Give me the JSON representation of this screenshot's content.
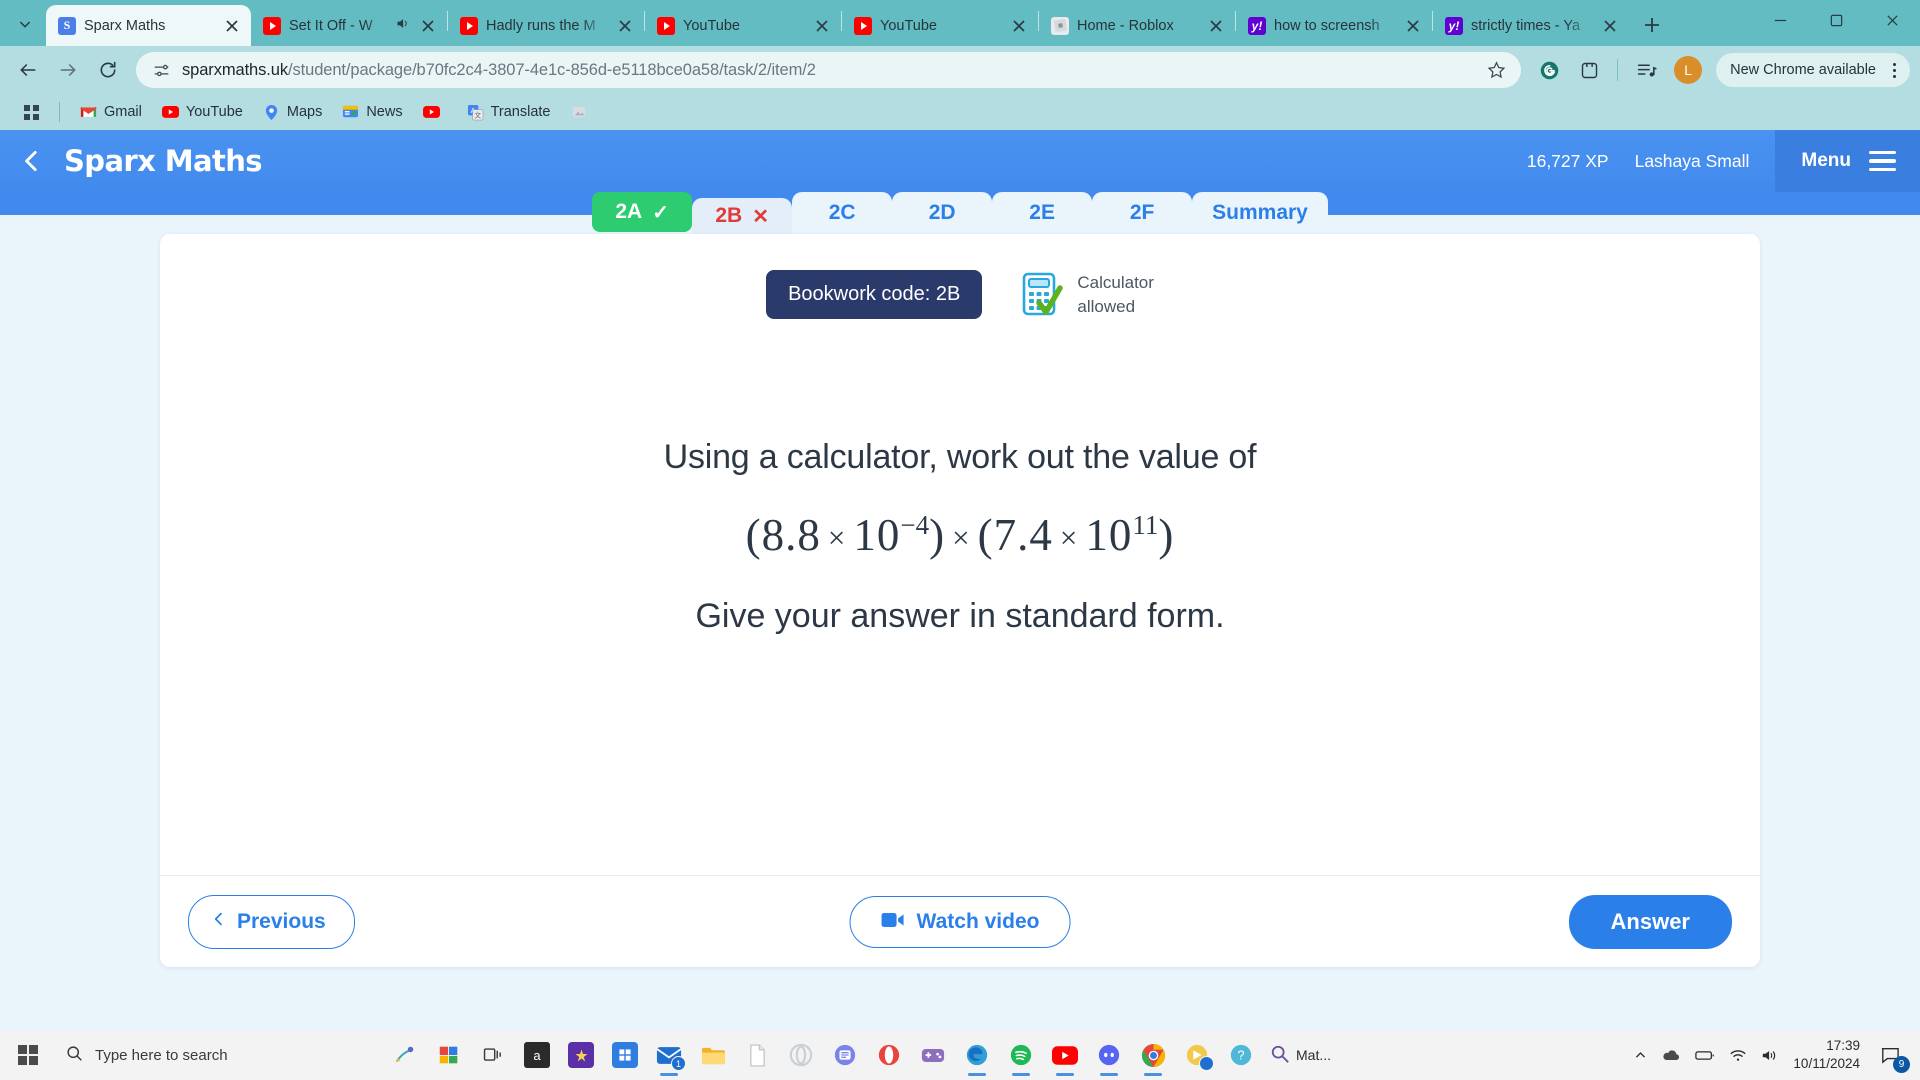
{
  "browser": {
    "tabs": [
      {
        "title": "Sparx Maths",
        "favicon": "sparx-icon",
        "active": true,
        "audio": false
      },
      {
        "title": "Set It Off - W",
        "favicon": "youtube-icon",
        "active": false,
        "audio": true
      },
      {
        "title": "Hadly runs the M",
        "favicon": "youtube-icon",
        "active": false,
        "audio": false
      },
      {
        "title": "YouTube",
        "favicon": "youtube-icon",
        "active": false,
        "audio": false
      },
      {
        "title": "YouTube",
        "favicon": "youtube-icon",
        "active": false,
        "audio": false
      },
      {
        "title": "Home - Roblox",
        "favicon": "roblox-icon",
        "active": false,
        "audio": false
      },
      {
        "title": "how to screensh",
        "favicon": "yahoo-icon",
        "active": false,
        "audio": false
      },
      {
        "title": "strictly times - Ya",
        "favicon": "yahoo-icon",
        "active": false,
        "audio": false
      }
    ],
    "newtab_label": "+",
    "toolbar": {
      "back_icon": "back-arrow-icon",
      "forward_icon": "forward-arrow-icon",
      "reload_icon": "reload-icon",
      "site_settings_icon": "tune-icon",
      "url_domain": "sparxmaths.uk",
      "url_path": "/student/package/b70fc2c4-3807-4e1c-856d-e5118bce0a58/task/2/item/2",
      "bookmark_icon": "star-icon",
      "grammarly_icon": "grammarly-icon",
      "extensions_icon": "extensions-icon",
      "readinglist_icon": "reading-list-icon",
      "profile_initial": "L",
      "update_label": "New Chrome available"
    },
    "bookmarks": [
      {
        "label": "Gmail",
        "icon": "gmail-icon"
      },
      {
        "label": "YouTube",
        "icon": "youtube-icon"
      },
      {
        "label": "Maps",
        "icon": "maps-icon"
      },
      {
        "label": "News",
        "icon": "news-icon"
      },
      {
        "label": "",
        "icon": "youtube-icon"
      },
      {
        "label": "Translate",
        "icon": "translate-icon"
      },
      {
        "label": "",
        "icon": "unknown-icon"
      }
    ],
    "apps_icon": "apps-grid-icon"
  },
  "sparx": {
    "back_icon": "chevron-left-icon",
    "brand": "Sparx Maths",
    "xp": "16,727 XP",
    "user": "Lashaya Small",
    "menu_label": "Menu",
    "menu_icon": "hamburger-icon",
    "task_tabs": [
      {
        "label": "2A",
        "state": "done",
        "mark": "✓"
      },
      {
        "label": "2B",
        "state": "wrong",
        "mark": "✕"
      },
      {
        "label": "2C",
        "state": "normal",
        "mark": ""
      },
      {
        "label": "2D",
        "state": "normal",
        "mark": ""
      },
      {
        "label": "2E",
        "state": "normal",
        "mark": ""
      },
      {
        "label": "2F",
        "state": "normal",
        "mark": ""
      },
      {
        "label": "Summary",
        "state": "normal",
        "mark": ""
      }
    ],
    "bookwork_code": "Bookwork code: 2B",
    "calculator_icon": "calculator-allowed-icon",
    "calculator_line1": "Calculator",
    "calculator_line2": "allowed",
    "question": {
      "line1": "Using a calculator, work out the value of",
      "expr": {
        "open1": "(",
        "m1": "8.8",
        "times1": "×",
        "base1": "10",
        "exp1": "−4",
        "close1": ")",
        "times_mid": "×",
        "open2": "(",
        "m2": "7.4",
        "times2": "×",
        "base2": "10",
        "exp2": "11",
        "close2": ")"
      },
      "line2": "Give your answer in standard form."
    },
    "footer": {
      "previous_label": "Previous",
      "previous_icon": "chevron-left-icon",
      "video_label": "Watch video",
      "video_icon": "video-camera-icon",
      "answer_label": "Answer"
    },
    "colors": {
      "header_blue": "#4289ee",
      "accent_blue": "#2b7fe8",
      "done_green": "#2ecc71",
      "wrong_red": "#e03b3b",
      "code_navy": "#2a3a6b"
    }
  },
  "taskbar": {
    "start_icon": "windows-start-icon",
    "search_icon": "search-icon",
    "search_placeholder": "Type here to search",
    "taskview_icon": "task-view-icon",
    "apps": [
      {
        "name": "snip-icon",
        "badge": ""
      },
      {
        "name": "paint-3d-icon",
        "badge": ""
      },
      {
        "name": "task-view-icon",
        "badge": ""
      },
      {
        "name": "amazon-icon",
        "badge": ""
      },
      {
        "name": "store-purple-icon",
        "badge": ""
      },
      {
        "name": "microsoft-store-icon",
        "badge": ""
      },
      {
        "name": "mail-icon",
        "badge": "1"
      },
      {
        "name": "file-explorer-icon",
        "badge": ""
      },
      {
        "name": "document-icon",
        "badge": ""
      },
      {
        "name": "opera-gx-icon",
        "badge": ""
      },
      {
        "name": "teams-icon",
        "badge": ""
      },
      {
        "name": "opera-icon",
        "badge": ""
      },
      {
        "name": "games-icon",
        "badge": ""
      },
      {
        "name": "edge-icon",
        "badge": ""
      },
      {
        "name": "spotify-icon",
        "badge": ""
      },
      {
        "name": "youtube-icon",
        "badge": ""
      },
      {
        "name": "discord-icon",
        "badge": ""
      },
      {
        "name": "chrome-icon",
        "badge": ""
      },
      {
        "name": "clipchamp-icon",
        "badge": ""
      },
      {
        "name": "help-icon",
        "badge": ""
      }
    ],
    "search_app_label": "Mat...",
    "search_app_icon": "search-color-icon",
    "tray": {
      "chevron_icon": "chevron-up-icon",
      "onedrive_icon": "onedrive-icon",
      "battery_icon": "battery-icon",
      "wifi_icon": "wifi-icon",
      "volume_icon": "volume-icon",
      "time": "17:39",
      "date": "10/11/2024",
      "notification_icon": "notification-icon",
      "notification_count": "9"
    }
  }
}
